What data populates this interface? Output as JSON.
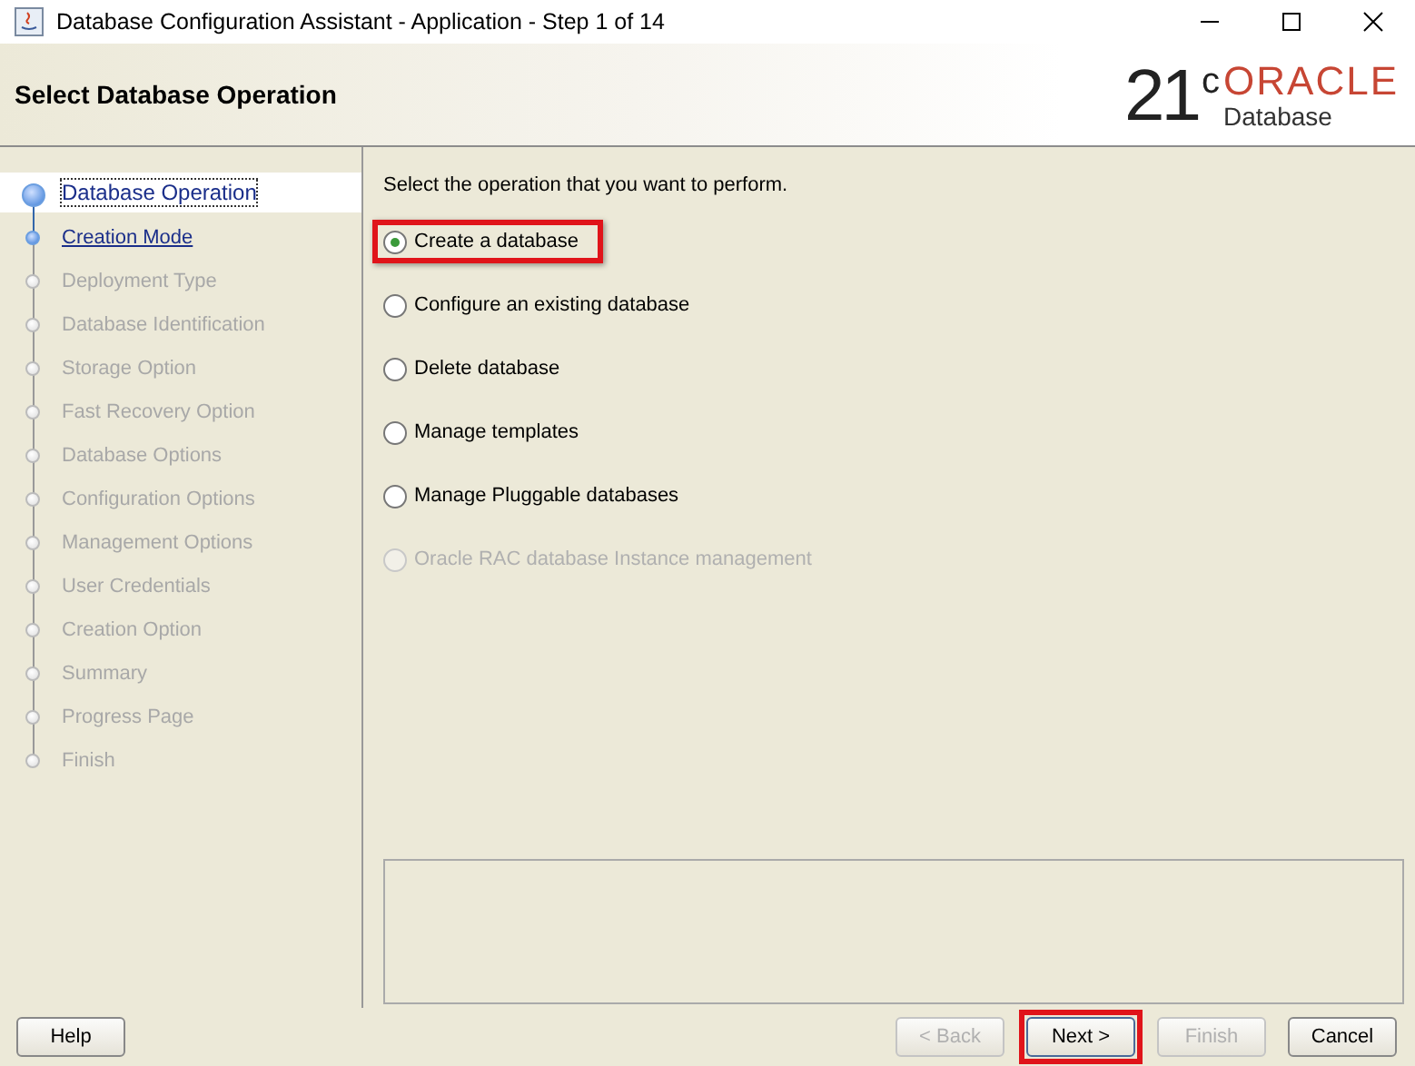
{
  "window": {
    "title": "Database Configuration Assistant - Application - Step 1 of 14"
  },
  "header": {
    "title": "Select Database Operation",
    "logo_version": "21",
    "logo_sup": "c",
    "logo_brand": "ORACLE",
    "logo_product": "Database"
  },
  "steps": [
    {
      "label": "Database Operation",
      "selected": true,
      "enabled": true
    },
    {
      "label": "Creation Mode",
      "selected": false,
      "enabled": true
    },
    {
      "label": "Deployment Type",
      "selected": false,
      "enabled": false
    },
    {
      "label": "Database Identification",
      "selected": false,
      "enabled": false
    },
    {
      "label": "Storage Option",
      "selected": false,
      "enabled": false
    },
    {
      "label": "Fast Recovery Option",
      "selected": false,
      "enabled": false
    },
    {
      "label": "Database Options",
      "selected": false,
      "enabled": false
    },
    {
      "label": "Configuration Options",
      "selected": false,
      "enabled": false
    },
    {
      "label": "Management Options",
      "selected": false,
      "enabled": false
    },
    {
      "label": "User Credentials",
      "selected": false,
      "enabled": false
    },
    {
      "label": "Creation Option",
      "selected": false,
      "enabled": false
    },
    {
      "label": "Summary",
      "selected": false,
      "enabled": false
    },
    {
      "label": "Progress Page",
      "selected": false,
      "enabled": false
    },
    {
      "label": "Finish",
      "selected": false,
      "enabled": false
    }
  ],
  "prompt": "Select the operation that you want to perform.",
  "options": [
    {
      "label": "Create a database",
      "selected": true,
      "disabled": false,
      "highlighted": true
    },
    {
      "label": "Configure an existing database",
      "selected": false,
      "disabled": false,
      "highlighted": false
    },
    {
      "label": "Delete database",
      "selected": false,
      "disabled": false,
      "highlighted": false
    },
    {
      "label": "Manage templates",
      "selected": false,
      "disabled": false,
      "highlighted": false
    },
    {
      "label": "Manage Pluggable databases",
      "selected": false,
      "disabled": false,
      "highlighted": false
    },
    {
      "label": "Oracle RAC database Instance management",
      "selected": false,
      "disabled": true,
      "highlighted": false
    }
  ],
  "buttons": {
    "help": {
      "label": "Help"
    },
    "nav": [
      {
        "label": "< Back",
        "disabled": true,
        "highlighted": false
      },
      {
        "label": "Next >",
        "disabled": false,
        "highlighted": true
      },
      {
        "label": "Finish",
        "disabled": true,
        "highlighted": false
      },
      {
        "label": "Cancel",
        "disabled": false,
        "highlighted": false
      }
    ]
  }
}
